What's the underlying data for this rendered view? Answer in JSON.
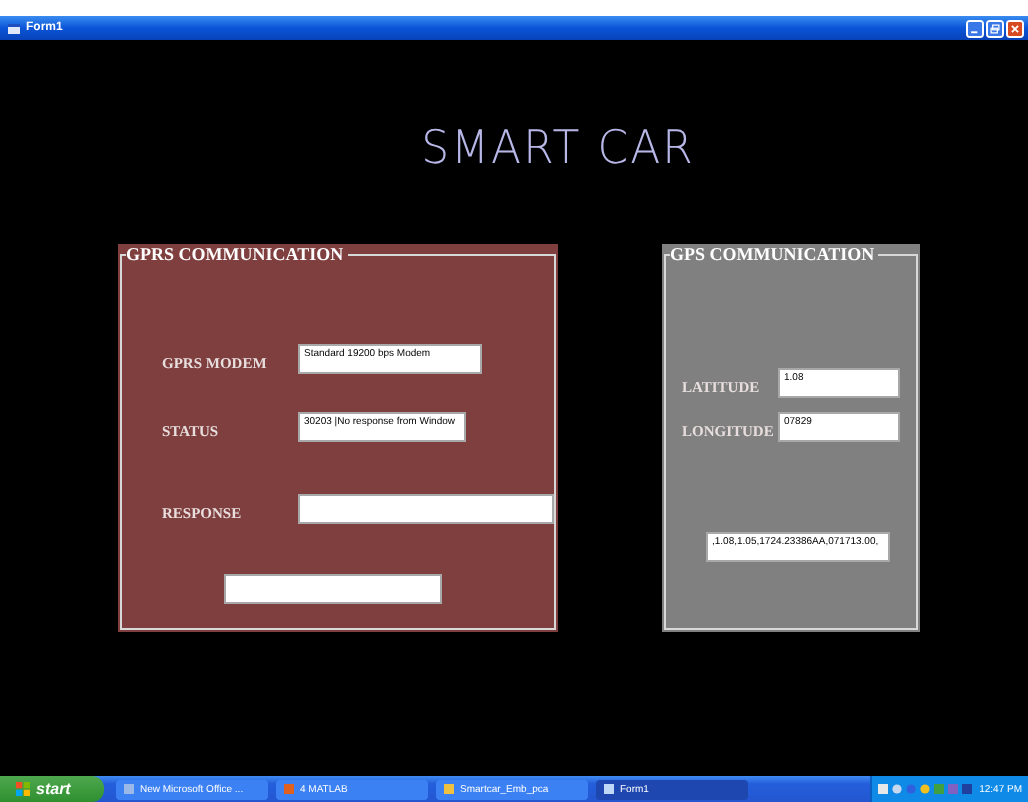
{
  "window": {
    "title": "Form1"
  },
  "heading": "SMART CAR",
  "gprs_panel": {
    "title": "GPRS COMMUNICATION",
    "rows": [
      {
        "label": "GPRS MODEM",
        "value": "Standard 19200 bps Modem"
      },
      {
        "label": "STATUS",
        "value": "30203 |No response from Window"
      },
      {
        "label": "RESPONSE"
      }
    ],
    "output": {
      "kind": "field"
    }
  },
  "gps_panel": {
    "title": "GPS COMMUNICATION",
    "rows": [
      {
        "label": "LATITUDE",
        "value": "1.08"
      },
      {
        "label": "LONGITUDE",
        "value": "07829"
      }
    ],
    "output": {
      "kind": "field",
      "value": ",1.08,1.05,1724.23386AA,071713.00,"
    }
  },
  "taskbar": {
    "start": "start",
    "items": [
      {
        "label": "New Microsoft Office ...",
        "selected": false
      },
      {
        "label": "4 MATLAB",
        "selected": false
      },
      {
        "label": "Smartcar_Emb_pca",
        "selected": false
      },
      {
        "label": "Form1",
        "selected": true
      }
    ],
    "clock": "12:47 PM"
  }
}
